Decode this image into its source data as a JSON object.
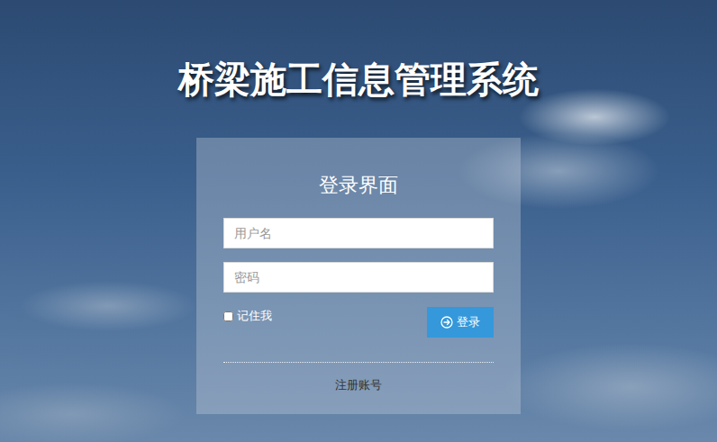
{
  "title": "桥梁施工信息管理系统",
  "login_form": {
    "heading": "登录界面",
    "username": {
      "placeholder": "用户名",
      "value": ""
    },
    "password": {
      "placeholder": "密码",
      "value": ""
    },
    "remember": {
      "label": "记住我",
      "checked": false
    },
    "submit": {
      "label": "登录"
    },
    "register_link": "注册账号"
  }
}
